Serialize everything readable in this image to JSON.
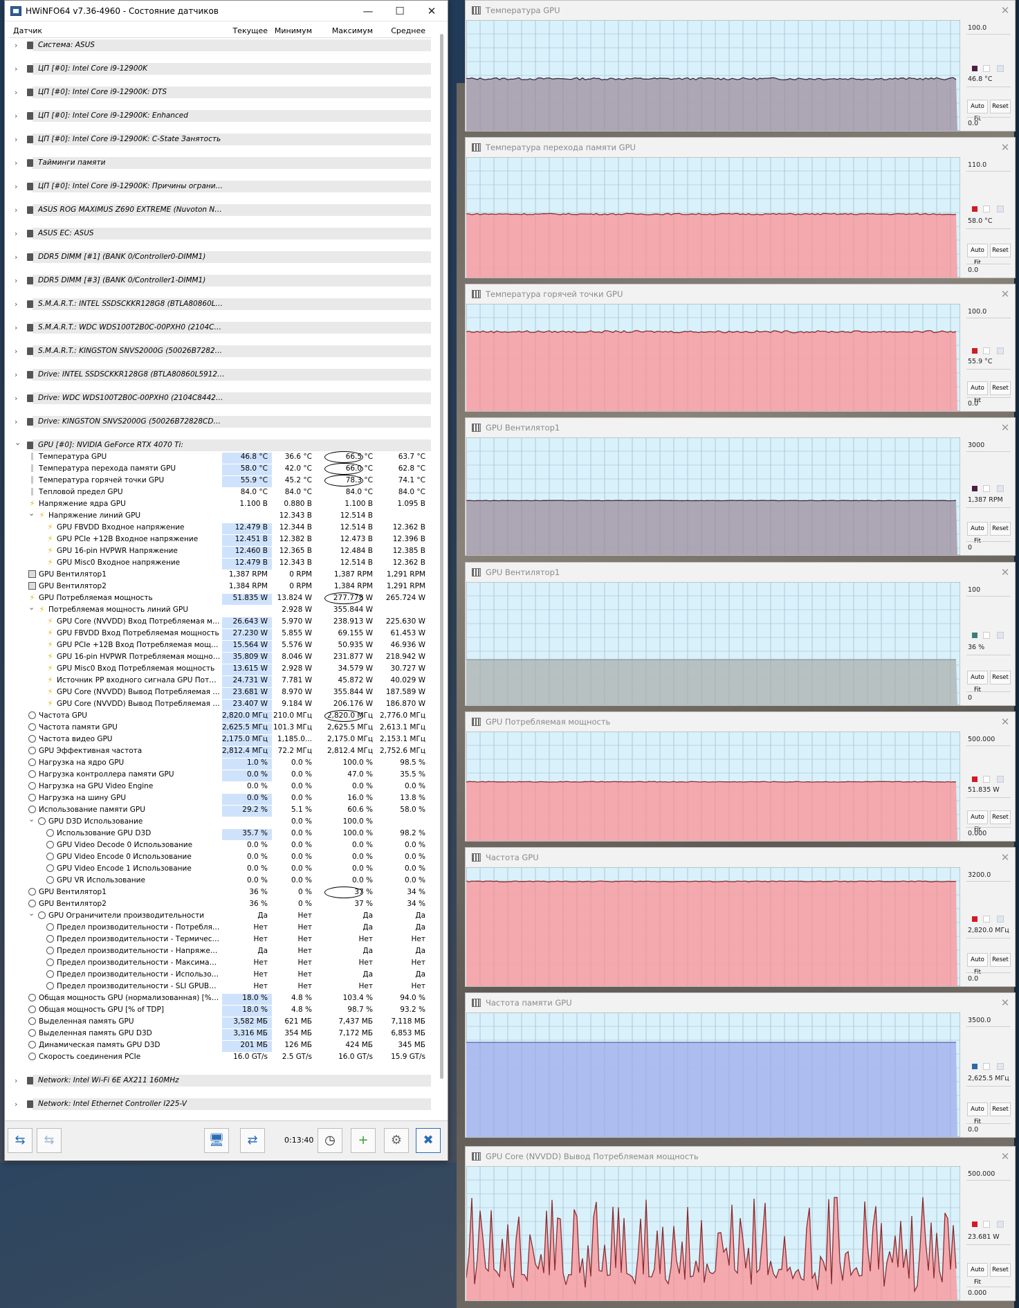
{
  "window": {
    "title": "HWiNFO64 v7.36-4960 - Состояние датчиков",
    "columns": [
      "Датчик",
      "Текущее",
      "Минимум",
      "Максимум",
      "Среднее"
    ],
    "timer": "0:13:40"
  },
  "groups_top": [
    "Система: ASUS",
    "ЦП [#0]: Intel Core i9-12900K",
    "ЦП [#0]: Intel Core i9-12900K: DTS",
    "ЦП [#0]: Intel Core i9-12900K: Enhanced",
    "ЦП [#0]: Intel Core i9-12900K: C-State Занятость",
    "Тайминги памяти",
    "ЦП [#0]: Intel Core i9-12900K: Причины ограниче...",
    "ASUS ROG MAXIMUS Z690 EXTREME (Nuvoton NCT...",
    "ASUS EC: ASUS",
    "DDR5 DIMM [#1] (BANK 0/Controller0-DIMM1)",
    "DDR5 DIMM [#3] (BANK 0/Controller1-DIMM1)",
    "S.M.A.R.T.: INTEL SSDSCKKR128G8 (BTLA80860L5...",
    "S.M.A.R.T.: WDC WDS100T2B0C-00PXH0 (2104C8...",
    "S.M.A.R.T.: KINGSTON SNVS2000G (50026B72828...",
    "Drive: INTEL SSDSCKKR128G8 (BTLA80860L59128I)",
    "Drive: WDC WDS100T2B0C-00PXH0 (2104C8442505)",
    "Drive: KINGSTON SNVS2000G (50026B72828CDA12)"
  ],
  "gpu_group": "GPU [#0]: NVIDIA GeForce RTX 4070 Ti:",
  "sensors": [
    {
      "i": 1,
      "t": "therm",
      "n": "Температура GPU",
      "c": "46.8 °C",
      "mn": "36.6 °C",
      "mx": "66.5 °C",
      "a": "63.7 °C",
      "h": 1,
      "o": 1
    },
    {
      "i": 1,
      "t": "therm",
      "n": "Температура перехода памяти GPU",
      "c": "58.0 °C",
      "mn": "42.0 °C",
      "mx": "66.0 °C",
      "a": "62.8 °C",
      "h": 1,
      "o": 1
    },
    {
      "i": 1,
      "t": "therm",
      "n": "Температура горячей точки GPU",
      "c": "55.9 °C",
      "mn": "45.2 °C",
      "mx": "78.3 °C",
      "a": "74.1 °C",
      "h": 1,
      "o": 1
    },
    {
      "i": 1,
      "t": "therm",
      "n": "Тепловой предел GPU",
      "c": "84.0 °C",
      "mn": "84.0 °C",
      "mx": "84.0 °C",
      "a": "84.0 °C"
    },
    {
      "i": 1,
      "t": "bolt",
      "n": "Напряжение ядра GPU",
      "c": "1.100 В",
      "mn": "0.880 В",
      "mx": "1.100 В",
      "a": "1.095 В"
    },
    {
      "i": 2,
      "t": "bolt",
      "n": "Напряжение линий GPU",
      "c": "",
      "mn": "12.343 В",
      "mx": "12.514 В",
      "a": "",
      "e": 1
    },
    {
      "i": 3,
      "t": "bolt",
      "n": "GPU FBVDD Входное напряжение",
      "c": "12.479 В",
      "mn": "12.344 В",
      "mx": "12.514 В",
      "a": "12.362 В",
      "h": 1
    },
    {
      "i": 3,
      "t": "bolt",
      "n": "GPU PCIe +12В Входное напряжение",
      "c": "12.451 В",
      "mn": "12.382 В",
      "mx": "12.473 В",
      "a": "12.396 В",
      "h": 1
    },
    {
      "i": 3,
      "t": "bolt",
      "n": "GPU 16-pin HVPWR Напряжение",
      "c": "12.460 В",
      "mn": "12.365 В",
      "mx": "12.484 В",
      "a": "12.385 В",
      "h": 1
    },
    {
      "i": 3,
      "t": "bolt",
      "n": "GPU Misc0 Входное напряжение",
      "c": "12.479 В",
      "mn": "12.343 В",
      "mx": "12.514 В",
      "a": "12.362 В",
      "h": 1
    },
    {
      "i": 1,
      "t": "fan",
      "n": "GPU Вентилятор1",
      "c": "1,387 RPM",
      "mn": "0 RPM",
      "mx": "1,387 RPM",
      "a": "1,291 RPM"
    },
    {
      "i": 1,
      "t": "fan",
      "n": "GPU Вентилятор2",
      "c": "1,384 RPM",
      "mn": "0 RPM",
      "mx": "1,384 RPM",
      "a": "1,291 RPM"
    },
    {
      "i": 1,
      "t": "bolt",
      "n": "GPU Потребляемая мощность",
      "c": "51.835 W",
      "mn": "13.824 W",
      "mx": "277.778 W",
      "a": "265.724 W",
      "h": 1,
      "o": 1
    },
    {
      "i": 2,
      "t": "bolt",
      "n": "Потребляемая мощность линий GPU",
      "c": "",
      "mn": "2.928 W",
      "mx": "355.844 W",
      "a": "",
      "e": 1
    },
    {
      "i": 3,
      "t": "bolt",
      "n": "GPU Core (NVVDD) Вход Потребляемая мощно...",
      "c": "26.643 W",
      "mn": "5.970 W",
      "mx": "238.913 W",
      "a": "225.630 W",
      "h": 1
    },
    {
      "i": 3,
      "t": "bolt",
      "n": "GPU FBVDD Вход Потребляемая мощность",
      "c": "27.230 W",
      "mn": "5.855 W",
      "mx": "69.155 W",
      "a": "61.453 W",
      "h": 1
    },
    {
      "i": 3,
      "t": "bolt",
      "n": "GPU PCIe +12В Вход Потребляемая мощность",
      "c": "15.564 W",
      "mn": "5.576 W",
      "mx": "50.935 W",
      "a": "46.936 W",
      "h": 1
    },
    {
      "i": 3,
      "t": "bolt",
      "n": "GPU 16-pin HVPWR Потребляемая мощность",
      "c": "35.809 W",
      "mn": "8.046 W",
      "mx": "231.877 W",
      "a": "218.942 W",
      "h": 1
    },
    {
      "i": 3,
      "t": "bolt",
      "n": "GPU Misc0 Вход Потребляемая мощность",
      "c": "13.615 W",
      "mn": "2.928 W",
      "mx": "34.579 W",
      "a": "30.727 W",
      "h": 1
    },
    {
      "i": 3,
      "t": "bolt",
      "n": "Источник PP входного сигнала GPU Потребля...",
      "c": "24.731 W",
      "mn": "7.781 W",
      "mx": "45.872 W",
      "a": "40.029 W",
      "h": 1
    },
    {
      "i": 3,
      "t": "bolt",
      "n": "GPU Core (NVVDD) Вывод Потребляемая мощн...",
      "c": "23.681 W",
      "mn": "8.970 W",
      "mx": "355.844 W",
      "a": "187.589 W",
      "h": 1
    },
    {
      "i": 3,
      "t": "bolt",
      "n": "GPU Core (NVVDD) Вывод Потребляемая мощн...",
      "c": "23.407 W",
      "mn": "9.184 W",
      "mx": "206.176 W",
      "a": "186.870 W",
      "h": 1
    },
    {
      "i": 1,
      "t": "clk",
      "n": "Частота GPU",
      "c": "2,820.0 МГц",
      "mn": "210.0 МГц",
      "mx": "2,820.0 МГц",
      "a": "2,776.0 МГц",
      "h": 1,
      "o": 1
    },
    {
      "i": 1,
      "t": "clk",
      "n": "Частота памяти GPU",
      "c": "2,625.5 МГц",
      "mn": "101.3 МГц",
      "mx": "2,625.5 МГц",
      "a": "2,613.1 МГц",
      "h": 1
    },
    {
      "i": 1,
      "t": "clk",
      "n": "Частота видео GPU",
      "c": "2,175.0 МГц",
      "mn": "1,185.0...",
      "mx": "2,175.0 МГц",
      "a": "2,153.1 МГц",
      "h": 1
    },
    {
      "i": 1,
      "t": "clk",
      "n": "GPU Эффективная частота",
      "c": "2,812.4 МГц",
      "mn": "72.2 МГц",
      "mx": "2,812.4 МГц",
      "a": "2,752.6 МГц",
      "h": 1
    },
    {
      "i": 1,
      "t": "clk",
      "n": "Нагрузка на ядро GPU",
      "c": "1.0 %",
      "mn": "0.0 %",
      "mx": "100.0 %",
      "a": "98.5 %",
      "h": 1
    },
    {
      "i": 1,
      "t": "clk",
      "n": "Нагрузка контроллера памяти GPU",
      "c": "0.0 %",
      "mn": "0.0 %",
      "mx": "47.0 %",
      "a": "35.5 %",
      "h": 1
    },
    {
      "i": 1,
      "t": "clk",
      "n": "Нагрузка на GPU Video Engine",
      "c": "0.0 %",
      "mn": "0.0 %",
      "mx": "0.0 %",
      "a": "0.0 %"
    },
    {
      "i": 1,
      "t": "clk",
      "n": "Нагрузка на шину GPU",
      "c": "0.0 %",
      "mn": "0.0 %",
      "mx": "16.0 %",
      "a": "13.8 %",
      "h": 1
    },
    {
      "i": 1,
      "t": "clk",
      "n": "Использование памяти GPU",
      "c": "29.2 %",
      "mn": "5.1 %",
      "mx": "60.6 %",
      "a": "58.0 %",
      "h": 1
    },
    {
      "i": 2,
      "t": "clk",
      "n": "GPU D3D Использование",
      "c": "",
      "mn": "0.0 %",
      "mx": "100.0 %",
      "a": "",
      "e": 1
    },
    {
      "i": 3,
      "t": "clk",
      "n": "Использование GPU D3D",
      "c": "35.7 %",
      "mn": "0.0 %",
      "mx": "100.0 %",
      "a": "98.2 %",
      "h": 1
    },
    {
      "i": 3,
      "t": "clk",
      "n": "GPU Video Decode 0 Использование",
      "c": "0.0 %",
      "mn": "0.0 %",
      "mx": "0.0 %",
      "a": "0.0 %"
    },
    {
      "i": 3,
      "t": "clk",
      "n": "GPU Video Encode 0 Использование",
      "c": "0.0 %",
      "mn": "0.0 %",
      "mx": "0.0 %",
      "a": "0.0 %"
    },
    {
      "i": 3,
      "t": "clk",
      "n": "GPU Video Encode 1 Использование",
      "c": "0.0 %",
      "mn": "0.0 %",
      "mx": "0.0 %",
      "a": "0.0 %"
    },
    {
      "i": 3,
      "t": "clk",
      "n": "GPU VR Использование",
      "c": "0.0 %",
      "mn": "0.0 %",
      "mx": "0.0 %",
      "a": "0.0 %"
    },
    {
      "i": 1,
      "t": "clk",
      "n": "GPU Вентилятор1",
      "c": "36 %",
      "mn": "0 %",
      "mx": "37 %",
      "a": "34 %",
      "o": 1
    },
    {
      "i": 1,
      "t": "clk",
      "n": "GPU Вентилятор2",
      "c": "36 %",
      "mn": "0 %",
      "mx": "37 %",
      "a": "34 %"
    },
    {
      "i": 2,
      "t": "clk",
      "n": "GPU Ограничители производительности",
      "c": "Да",
      "mn": "Нет",
      "mx": "Да",
      "a": "Да",
      "e": 1
    },
    {
      "i": 3,
      "t": "clk",
      "n": "Предел производительности - Потребляемая ...",
      "c": "Нет",
      "mn": "Нет",
      "mx": "Да",
      "a": "Да"
    },
    {
      "i": 3,
      "t": "clk",
      "n": "Предел производительности - Термический",
      "c": "Нет",
      "mn": "Нет",
      "mx": "Нет",
      "a": "Нет"
    },
    {
      "i": 3,
      "t": "clk",
      "n": "Предел производительности - Напряжение н...",
      "c": "Да",
      "mn": "Нет",
      "mx": "Да",
      "a": "Да"
    },
    {
      "i": 3,
      "t": "clk",
      "n": "Предел производительности - Максимальное ...",
      "c": "Нет",
      "mn": "Нет",
      "mx": "Нет",
      "a": "Нет"
    },
    {
      "i": 3,
      "t": "clk",
      "n": "Предел производительности - Использование",
      "c": "Нет",
      "mn": "Нет",
      "mx": "Да",
      "a": "Да"
    },
    {
      "i": 3,
      "t": "clk",
      "n": "Предел производительности - SLI GPUBoost S...",
      "c": "Нет",
      "mn": "Нет",
      "mx": "Нет",
      "a": "Нет"
    },
    {
      "i": 1,
      "t": "clk",
      "n": "Общая мощность GPU (нормализованная) [% of ...",
      "c": "18.0 %",
      "mn": "4.8 %",
      "mx": "103.4 %",
      "a": "94.0 %",
      "h": 1
    },
    {
      "i": 1,
      "t": "clk",
      "n": "Общая мощность GPU [% of TDP]",
      "c": "18.0 %",
      "mn": "4.8 %",
      "mx": "98.7 %",
      "a": "93.2 %",
      "h": 1
    },
    {
      "i": 1,
      "t": "clk",
      "n": "Выделенная память GPU",
      "c": "3,582 МБ",
      "mn": "621 МБ",
      "mx": "7,437 МБ",
      "a": "7,118 МБ",
      "h": 1
    },
    {
      "i": 1,
      "t": "clk",
      "n": "Выделенная память GPU D3D",
      "c": "3,316 МБ",
      "mn": "354 МБ",
      "mx": "7,172 МБ",
      "a": "6,853 МБ",
      "h": 1
    },
    {
      "i": 1,
      "t": "clk",
      "n": "Динамическая память GPU D3D",
      "c": "201 МБ",
      "mn": "126 МБ",
      "mx": "424 МБ",
      "a": "345 МБ",
      "h": 1
    },
    {
      "i": 1,
      "t": "clk",
      "n": "Скорость соединения PCIe",
      "c": "16.0 GT/s",
      "mn": "2.5 GT/s",
      "mx": "16.0 GT/s",
      "a": "15.9 GT/s"
    }
  ],
  "groups_bottom": [
    "Network: Intel Wi-Fi 6E AX211 160MHz",
    "Network: Intel Ethernet Controller I225-V"
  ],
  "charts": [
    {
      "title": "Температура GPU",
      "max": "100.0",
      "min": "0.0",
      "cur": "46.8 °C",
      "fill": "#a99fae",
      "line": "#3a2a3a",
      "sw": "#4b1e45",
      "level": 0.47,
      "noise": 0.01
    },
    {
      "title": "Температура перехода памяти GPU",
      "max": "110.0",
      "min": "0.0",
      "cur": "58.0 °C",
      "fill": "#f5a3a7",
      "line": "#8b2c2f",
      "sw": "#d11b22",
      "level": 0.527,
      "noise": 0.006
    },
    {
      "title": "Температура горячей точки GPU",
      "max": "100.0",
      "min": "0.0",
      "cur": "55.9 °C",
      "fill": "#f5a3a7",
      "line": "#8b2c2f",
      "sw": "#d11b22",
      "level": 0.74,
      "noise": 0.01
    },
    {
      "title": "GPU Вентилятор1",
      "max": "3000",
      "min": "0",
      "cur": "1,387 RPM",
      "fill": "#a99fae",
      "line": "#3a2a3a",
      "sw": "#4b1e45",
      "level": 0.463,
      "noise": 0.002
    },
    {
      "title": "GPU Вентилятор1",
      "max": "100",
      "min": "0",
      "cur": "36 %",
      "fill": "#b4bdbd",
      "line": "#8a9494",
      "sw": "#3c7e7c",
      "level": 0.37,
      "noise": 0.0
    },
    {
      "title": "GPU Потребляемая мощность",
      "max": "500.000",
      "min": "0.000",
      "cur": "51.835 W",
      "fill": "#f5a3a7",
      "line": "#8b2c2f",
      "sw": "#d11b22",
      "level": 0.54,
      "noise": 0.003
    },
    {
      "title": "Частота GPU",
      "max": "3200.0",
      "min": "0.0",
      "cur": "2,820.0 МГц",
      "fill": "#f5a3a7",
      "line": "#8b2c2f",
      "sw": "#d11b22",
      "level": 0.88,
      "noise": 0.004
    },
    {
      "title": "Частота памяти GPU",
      "max": "3500.0",
      "min": "0.0",
      "cur": "2,625.5 МГц",
      "fill": "#a9b8ef",
      "line": "#5a6fb6",
      "sw": "#2d6aa8",
      "level": 0.76,
      "noise": 0.0
    },
    {
      "title": "GPU Core (NVVDD) Вывод Потребляемая мощность",
      "max": "500.000",
      "min": "0.000",
      "cur": "23.681 W",
      "fill": "#f5a3a7",
      "line": "#8b2c2f",
      "sw": "#d11b22",
      "level": 0.42,
      "noise": 0.22
    }
  ],
  "chart_buttons": {
    "auto": "Auto Fit",
    "reset": "Reset"
  }
}
